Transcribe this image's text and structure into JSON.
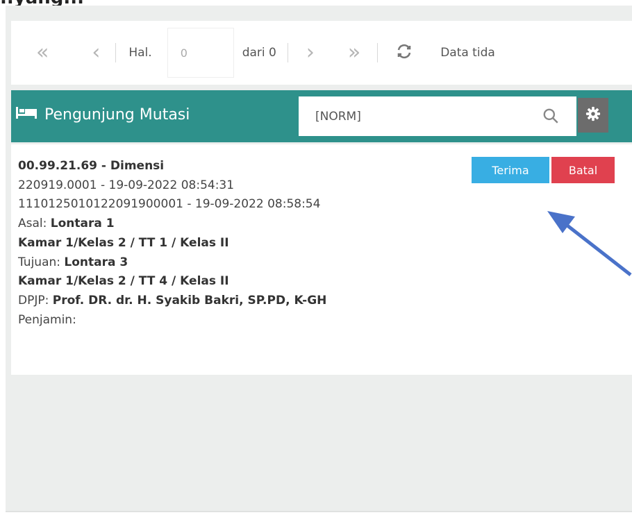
{
  "page": {
    "title_cut": "..yang..."
  },
  "pager": {
    "first_icon": "«",
    "prev_icon": "‹",
    "hal_label": "Hal.",
    "page_value": "0",
    "of_label": "dari 0",
    "next_icon": "›",
    "last_icon": "»",
    "status_text": "Data tida"
  },
  "header": {
    "title": "Pengunjung Mutasi",
    "search_value": "[NORM]"
  },
  "record": {
    "line1_bold": "00.99.21.69 - Dimensi",
    "line2": "220919.0001 - 19-09-2022 08:54:31",
    "line3": "1110125010122091900001 - 19-09-2022 08:58:54",
    "asal_label": "Asal:",
    "asal_value": "Lontara 1",
    "kamar1": "Kamar 1/Kelas 2 / TT 1 / Kelas II",
    "tujuan_label": "Tujuan:",
    "tujuan_value": "Lontara 3",
    "kamar2": "Kamar 1/Kelas 2 / TT 4 / Kelas II",
    "dpjp_label": "DPJP:",
    "dpjp_value": "Prof. DR. dr. H. Syakib Bakri, SP.PD, K-GH",
    "penjamin_label": "Penjamin:"
  },
  "actions": {
    "terima": "Terima",
    "batal": "Batal"
  },
  "colors": {
    "header": "#2e918b",
    "terima": "#38aee3",
    "batal": "#e0414f",
    "arrow": "#4a72c9"
  }
}
